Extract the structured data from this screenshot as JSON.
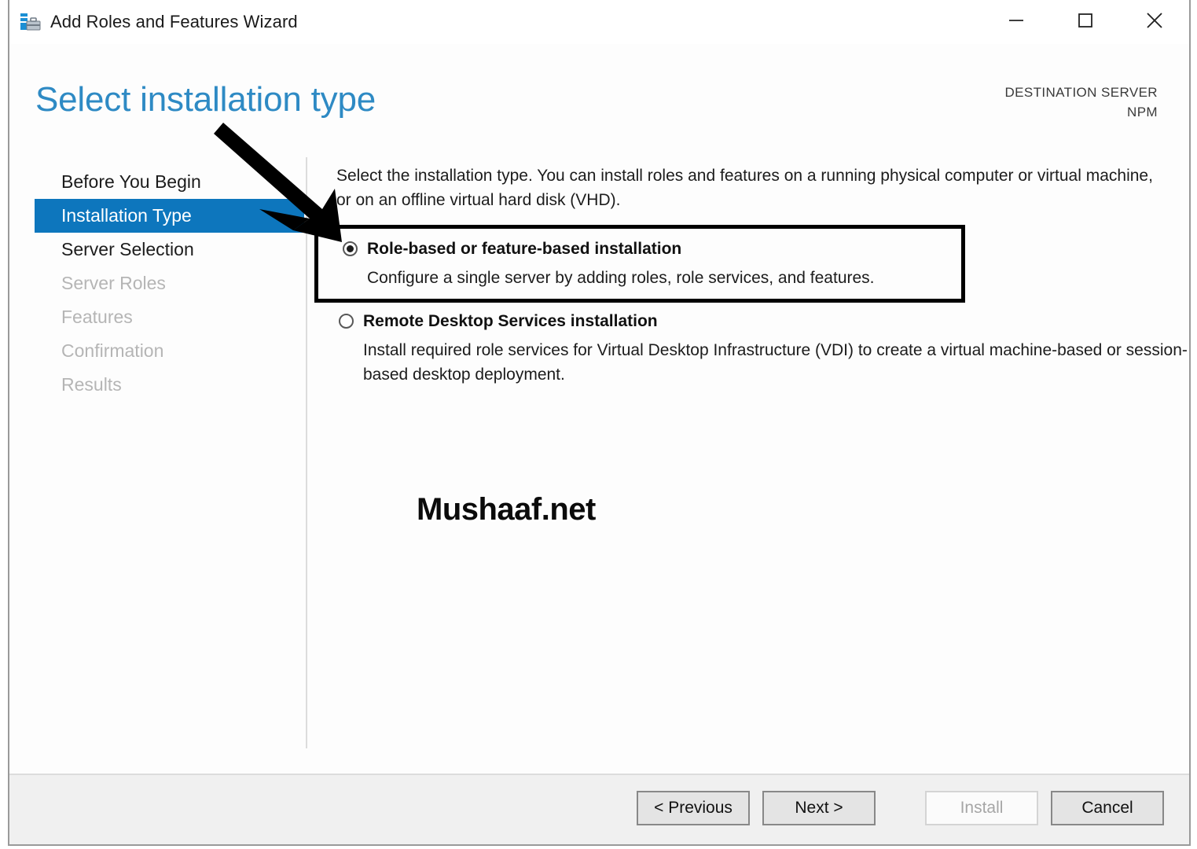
{
  "window": {
    "title": "Add Roles and Features Wizard",
    "icon": "server-toolbox-icon",
    "controls": {
      "minimize": "minimize-icon",
      "maximize": "maximize-icon",
      "close": "close-icon"
    }
  },
  "header": {
    "page_title": "Select installation type",
    "destination_label": "DESTINATION SERVER",
    "destination_value": "NPM"
  },
  "sidebar": {
    "items": [
      {
        "label": "Before You Begin",
        "state": "enabled"
      },
      {
        "label": "Installation Type",
        "state": "selected"
      },
      {
        "label": "Server Selection",
        "state": "enabled"
      },
      {
        "label": "Server Roles",
        "state": "disabled"
      },
      {
        "label": "Features",
        "state": "disabled"
      },
      {
        "label": "Confirmation",
        "state": "disabled"
      },
      {
        "label": "Results",
        "state": "disabled"
      }
    ]
  },
  "main": {
    "intro": "Select the installation type. You can install roles and features on a running physical computer or virtual machine, or on an offline virtual hard disk (VHD).",
    "options": [
      {
        "label": "Role-based or feature-based installation",
        "description": "Configure a single server by adding roles, role services, and features.",
        "selected": true,
        "highlighted": true
      },
      {
        "label": "Remote Desktop Services installation",
        "description": "Install required role services for Virtual Desktop Infrastructure (VDI) to create a virtual machine-based or session-based desktop deployment.",
        "selected": false,
        "highlighted": false
      }
    ]
  },
  "annotations": {
    "watermark": "Mushaaf.net",
    "arrow": "pointer-arrow-icon",
    "highlight_color": "#000000"
  },
  "footer": {
    "buttons": [
      {
        "label": "< Previous",
        "disabled": false
      },
      {
        "label": "Next >",
        "disabled": false
      },
      {
        "label": "Install",
        "disabled": true
      },
      {
        "label": "Cancel",
        "disabled": false
      }
    ]
  },
  "colors": {
    "accent_blue": "#0d76bd",
    "title_blue": "#2e8ac4",
    "window_bg": "#fdfdfd",
    "footer_bg": "#f0f0f0"
  }
}
